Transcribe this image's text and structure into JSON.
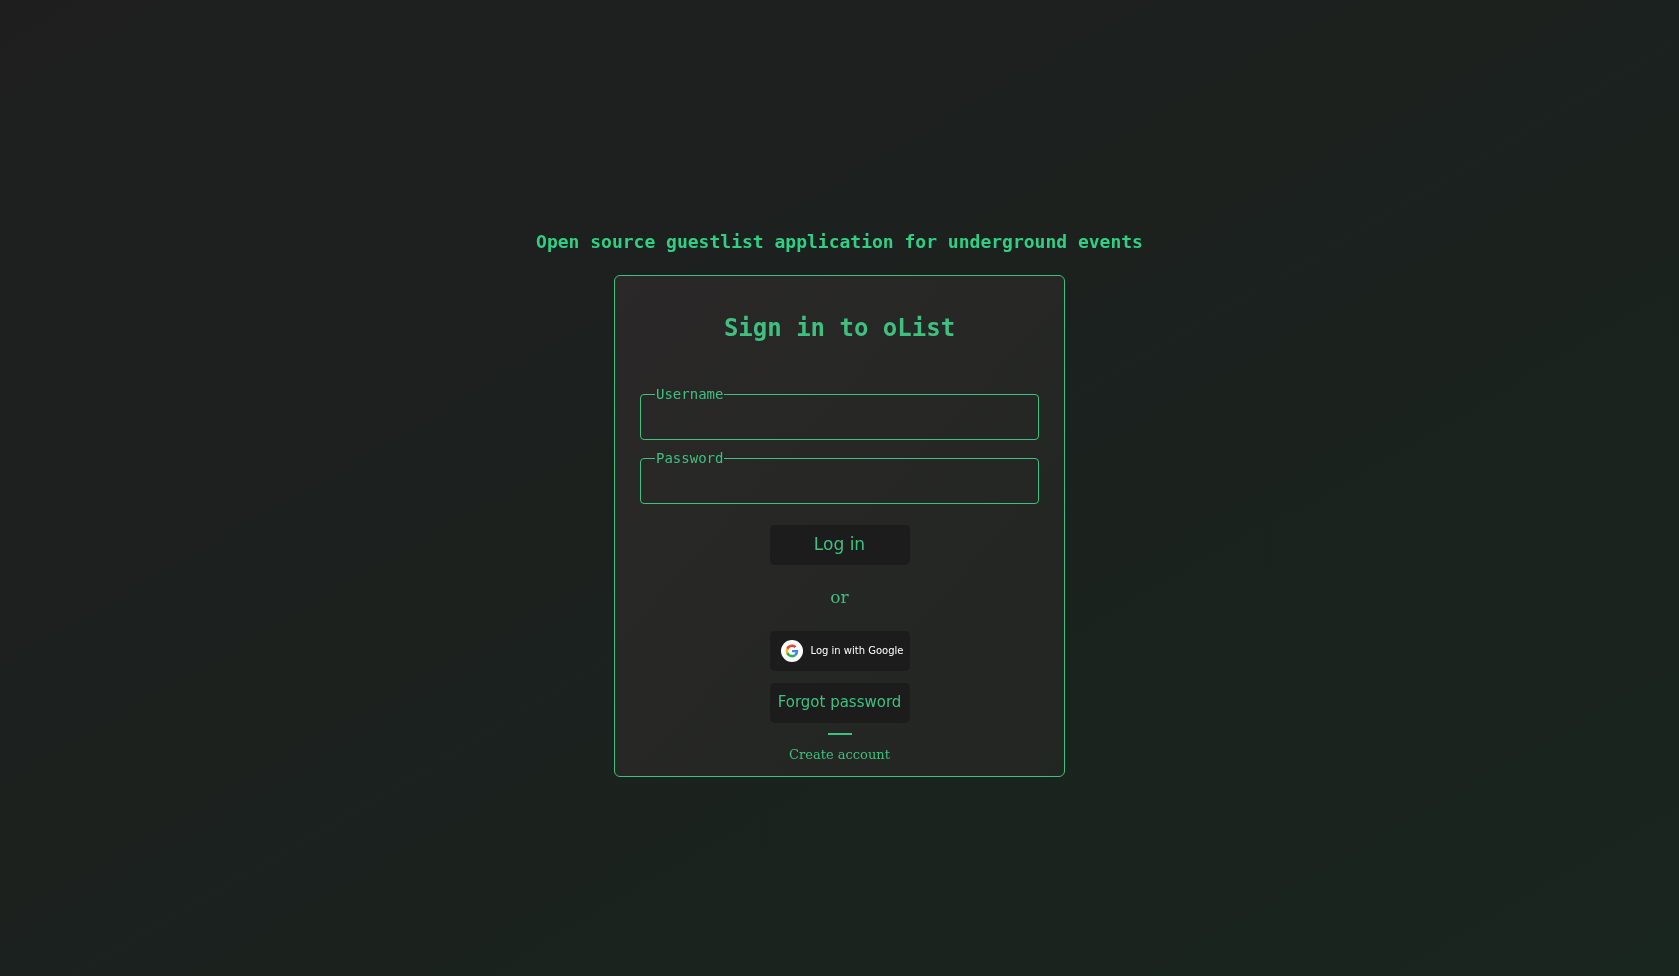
{
  "tagline": "Open source guestlist application for underground events",
  "card": {
    "title": "Sign in to oList",
    "fields": [
      {
        "label": "Username"
      },
      {
        "label": "Password"
      }
    ],
    "login_button": "Log in",
    "separator": "or",
    "google_button": "Log in with Google",
    "forgot_button": "Forgot password",
    "create_link": "Create account"
  }
}
